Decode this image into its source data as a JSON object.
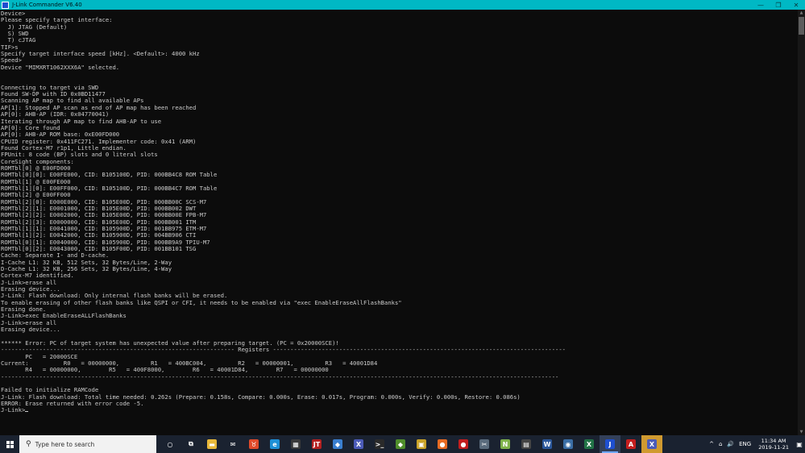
{
  "window": {
    "title": "J-Link Commander V6.40",
    "minimize": "—",
    "restore": "❐",
    "close": "✕"
  },
  "console": {
    "text": "Device>\nPlease specify target interface:\n  J) JTAG (Default)\n  S) SWD\n  T) cJTAG\nTIF>s\nSpecify target interface speed [kHz]. <Default>: 4000 kHz\nSpeed>\nDevice \"MIMXRT1062XXX6A\" selected.\n\n\nConnecting to target via SWD\nFound SW-DP with ID 0x0BD11477\nScanning AP map to find all available APs\nAP[1]: Stopped AP scan as end of AP map has been reached\nAP[0]: AHB-AP (IDR: 0x04770041)\nIterating through AP map to find AHB-AP to use\nAP[0]: Core found\nAP[0]: AHB-AP ROM base: 0xE00FD000\nCPUID register: 0x411FC271. Implementer code: 0x41 (ARM)\nFound Cortex-M7 r1p1, Little endian.\nFPUnit: 8 code (BP) slots and 0 literal slots\nCoreSight components:\nROMTbl[0] @ E00FD000\nROMTbl[0][0]: E00FE000, CID: B105100D, PID: 000BB4C8 ROM Table\nROMTbl[1] @ E00FE000\nROMTbl[1][0]: E00FF000, CID: B105100D, PID: 000BB4C7 ROM Table\nROMTbl[2] @ E00FF000\nROMTbl[2][0]: E000E000, CID: B105E00D, PID: 000BB00C SCS-M7\nROMTbl[2][1]: E0001000, CID: B105E00D, PID: 000BB002 DWT\nROMTbl[2][2]: E0002000, CID: B105E00D, PID: 000BB00E FPB-M7\nROMTbl[2][3]: E0000000, CID: B105E00D, PID: 000BB001 ITM\nROMTbl[1][1]: E0041000, CID: B105900D, PID: 001BB975 ETM-M7\nROMTbl[1][2]: E0042000, CID: B105900D, PID: 004BB906 CTI\nROMTbl[0][1]: E0040000, CID: B105900D, PID: 000BB9A9 TPIU-M7\nROMTbl[0][2]: E0043000, CID: B105F00D, PID: 001BB101 TSG\nCache: Separate I- and D-cache.\nI-Cache L1: 32 KB, 512 Sets, 32 Bytes/Line, 2-Way\nD-Cache L1: 32 KB, 256 Sets, 32 Bytes/Line, 4-Way\nCortex-M7 identified.\nJ-Link>erase all\nErasing device...\nJ-Link: Flash download: Only internal flash banks will be erased.\nTo enable erasing of other flash banks like QSPI or CFI, it needs to be enabled via \"exec EnableEraseAllFlashBanks\"\nErasing done.\nJ-Link>exec EnableEraseALLFlashBanks\nJ-Link>erase all\nErasing device...\n\n****** Error: PC of target system has unexpected value after preparing target. (PC = 0x20000SCE)!\n------------------------------------------------------------------- Registers ------------------------------------------------------------------------------------\n       PC   = 20000SCE\nCurrent:          R0   = 00000000,         R1   = 400BC004,         R2   = 00000001,         R3   = 40001D84\n       R4   = 00000000,        R5   = 400F8000,        R6   = 40001D84,        R7   = 00000000\n----------------------------------------------------------------------------------------------------------------------------------------------------------------\n\nFailed to initialize RAMCode\nJ-Link: Flash download: Total time needed: 0.262s (Prepare: 0.158s, Compare: 0.000s, Erase: 0.017s, Program: 0.000s, Verify: 0.000s, Restore: 0.086s)\nERROR: Erase returned with error code -5.\nJ-Link>"
  },
  "taskbar": {
    "search_placeholder": "Type here to search",
    "icons": [
      {
        "name": "cortana-circle-icon",
        "glyph": "○",
        "color": "#1a2230"
      },
      {
        "name": "task-view-icon",
        "glyph": "⧉",
        "color": "#1a2230"
      },
      {
        "name": "file-explorer-icon",
        "glyph": "▬",
        "color": "#e8b83a"
      },
      {
        "name": "mail-icon",
        "glyph": "✉",
        "color": "#1a2230"
      },
      {
        "name": "app-red-icon",
        "glyph": "♉",
        "color": "#e04a2a"
      },
      {
        "name": "edge-icon",
        "glyph": "e",
        "color": "#1e90d6"
      },
      {
        "name": "calculator-icon",
        "glyph": "▦",
        "color": "#3a3a3a"
      },
      {
        "name": "app-jt-icon",
        "glyph": "JT",
        "color": "#b32020"
      },
      {
        "name": "bird-app-icon",
        "glyph": "◆",
        "color": "#3a7fd0"
      },
      {
        "name": "app-x-blue-icon",
        "glyph": "X",
        "color": "#4b5bb8"
      },
      {
        "name": "command-prompt-icon",
        "glyph": ">_",
        "color": "#2a2a2a"
      },
      {
        "name": "app-green-icon",
        "glyph": "◆",
        "color": "#4f8d2b"
      },
      {
        "name": "app-yellow-icon",
        "glyph": "▣",
        "color": "#c9a227"
      },
      {
        "name": "firefox-icon",
        "glyph": "●",
        "color": "#e66a22"
      },
      {
        "name": "app-red-circle-icon",
        "glyph": "●",
        "color": "#c31e1e"
      },
      {
        "name": "tools-icon",
        "glyph": "✂",
        "color": "#5a6b7c"
      },
      {
        "name": "notepad-plus-icon",
        "glyph": "N",
        "color": "#7fb24a"
      },
      {
        "name": "app-window-icon",
        "glyph": "▤",
        "color": "#444"
      },
      {
        "name": "word-icon",
        "glyph": "W",
        "color": "#2b579a"
      },
      {
        "name": "app-web-icon",
        "glyph": "◉",
        "color": "#3a6ea5"
      },
      {
        "name": "excel-icon",
        "glyph": "X",
        "color": "#217346"
      },
      {
        "name": "jlink-icon",
        "glyph": "J",
        "color": "#1e4fd0",
        "active": true
      },
      {
        "name": "acrobat-icon",
        "glyph": "A",
        "color": "#c41e1e"
      },
      {
        "name": "app-x-active-icon",
        "glyph": "X",
        "color": "#4b5bb8",
        "highlight": true
      }
    ],
    "tray": {
      "chevron": "^",
      "network": "⌂",
      "volume": "🔊",
      "lang": "ENG",
      "time": "11:34 AM",
      "date": "2019-11-21",
      "notification": "▣"
    }
  }
}
